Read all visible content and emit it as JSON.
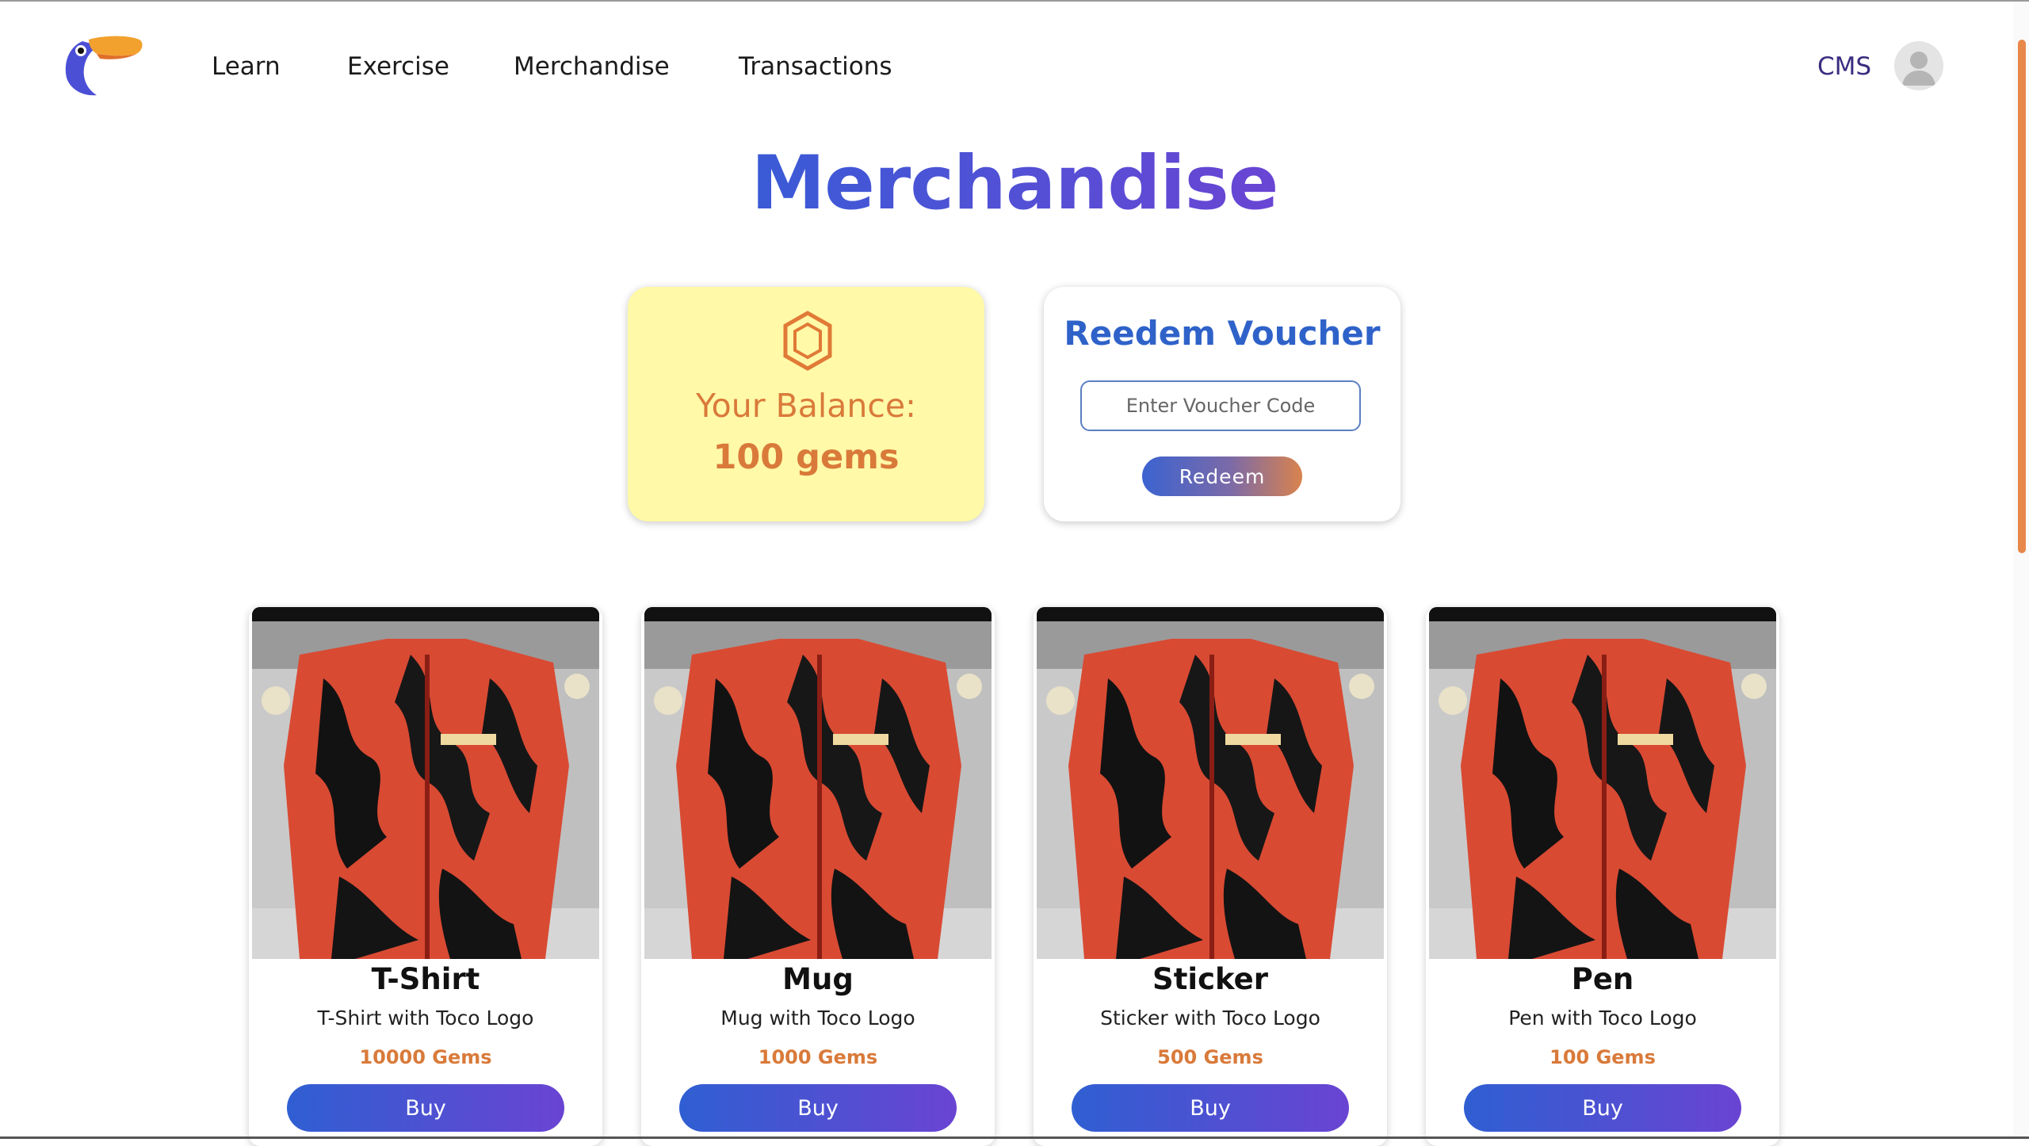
{
  "nav": {
    "links": [
      "Learn",
      "Exercise",
      "Merchandise",
      "Transactions"
    ],
    "cms_label": "CMS"
  },
  "page": {
    "title": "Merchandise"
  },
  "balance": {
    "label": "Your Balance:",
    "value": "100 gems"
  },
  "voucher": {
    "title": "Reedem Voucher",
    "placeholder": "Enter Voucher Code",
    "button_label": "Redeem"
  },
  "products": [
    {
      "name": "T-Shirt",
      "description": "T-Shirt with Toco Logo",
      "price": "10000 Gems",
      "button_label": "Buy"
    },
    {
      "name": "Mug",
      "description": "Mug with Toco Logo",
      "price": "1000 Gems",
      "button_label": "Buy"
    },
    {
      "name": "Sticker",
      "description": "Sticker with Toco Logo",
      "price": "500 Gems",
      "button_label": "Buy"
    },
    {
      "name": "Pen",
      "description": "Pen with Toco Logo",
      "price": "100 Gems",
      "button_label": "Buy"
    }
  ],
  "colors": {
    "accent_blue": "#3a5bd6",
    "accent_purple": "#6a45d4",
    "gem_orange": "#d97a3a",
    "balance_card_bg": "#fff9a8"
  },
  "icons": {
    "logo": "toucan-logo-icon",
    "avatar": "user-avatar-icon",
    "gem": "gem-hexagon-icon"
  }
}
